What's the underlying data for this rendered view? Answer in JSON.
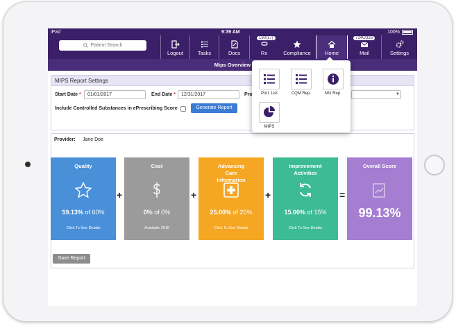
{
  "status": {
    "device": "iPad",
    "time": "9:39 AM",
    "battery": "100%"
  },
  "search": {
    "placeholder": "Patient Search"
  },
  "nav": {
    "logout": "Logout",
    "tasks": "Tasks",
    "docs": "Docs",
    "rx": "Rx",
    "rx_badge": "190(17)",
    "compliance": "Compliance",
    "home": "Home",
    "mail": "Mail",
    "mail_badge": "7340/326",
    "settings": "Settings"
  },
  "subbar": {
    "title": "Mips Overview"
  },
  "settings_panel": {
    "title": "MIPS Report Settings",
    "start_label": "Start Date",
    "start_value": "01/01/2017",
    "end_label": "End Date",
    "end_value": "12/31/2017",
    "provider_label_partial": "Pro",
    "controlled_label": "Include Controlled Substances in ePrescribing Score",
    "generate_button": "Generate Report",
    "required_mark": "*"
  },
  "report": {
    "provider_label": "Provider:",
    "provider_value": "Jane Doe",
    "save_button": "Save Report",
    "cards": [
      {
        "title": "Quality",
        "value": "59.13%",
        "of": "of 60%",
        "note": "Click To See Details",
        "color": "#4a90d9",
        "icon": "star-icon"
      },
      {
        "title": "Cost",
        "value": "0%",
        "of": "of 0%",
        "note": "Available 2018",
        "color": "#9b9b9b",
        "icon": "dollar-icon"
      },
      {
        "title": "Advancing Care Information",
        "value": "25.00%",
        "of": "of 25%",
        "note": "Click To See Details",
        "color": "#f5a623",
        "icon": "plus-box-icon"
      },
      {
        "title": "Improvement Activities",
        "value": "15.00%",
        "of": "of 15%",
        "note": "Click To See Details",
        "color": "#3dbb95",
        "icon": "refresh-icon"
      },
      {
        "title": "Overall Score",
        "value": "99.13%",
        "color": "#a57ed1",
        "icon": "report-chart-icon"
      }
    ],
    "operators": [
      "+",
      "+",
      "+",
      "="
    ]
  },
  "popover": {
    "items": [
      {
        "label": "Port. List",
        "icon": "list-icon"
      },
      {
        "label": "CQM Rep.",
        "icon": "list-icon"
      },
      {
        "label": "MU Rep.",
        "icon": "info-icon"
      },
      {
        "label": "MIPS",
        "icon": "pie-chart-icon"
      }
    ]
  }
}
